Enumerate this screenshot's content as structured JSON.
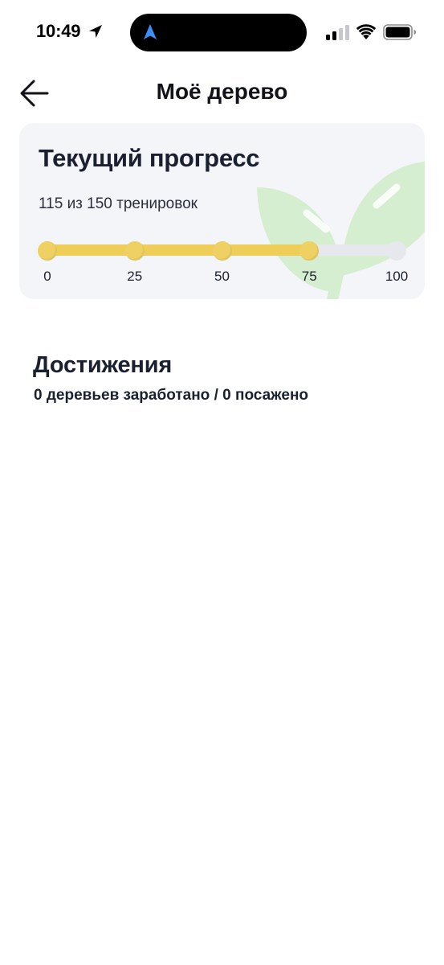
{
  "status_bar": {
    "time": "10:49",
    "icons": [
      "location-arrow-icon",
      "navigation-icon",
      "cellular-signal-icon",
      "wifi-icon",
      "battery-icon"
    ]
  },
  "header": {
    "title": "Моё дерево",
    "back_icon": "arrow-left-icon"
  },
  "progress_card": {
    "title": "Текущий прогресс",
    "subtitle": "115 из 150 тренировок",
    "progress_fraction": 0.75,
    "milestones": [
      {
        "label": "0",
        "reached": true
      },
      {
        "label": "25",
        "reached": true
      },
      {
        "label": "50",
        "reached": true
      },
      {
        "label": "75",
        "reached": true
      },
      {
        "label": "100",
        "reached": false
      }
    ],
    "decoration_icon": "sprout-leaves-icon"
  },
  "achievements": {
    "title": "Достижения",
    "summary": "0 деревьев заработано / 0 посажено"
  },
  "colors": {
    "accent": "#eed162",
    "track": "#e6e8ee",
    "card_bg": "#f4f5f8",
    "leaf": "#d4eecf",
    "text": "#1b2030",
    "island_icon": "#3b8ef5"
  }
}
